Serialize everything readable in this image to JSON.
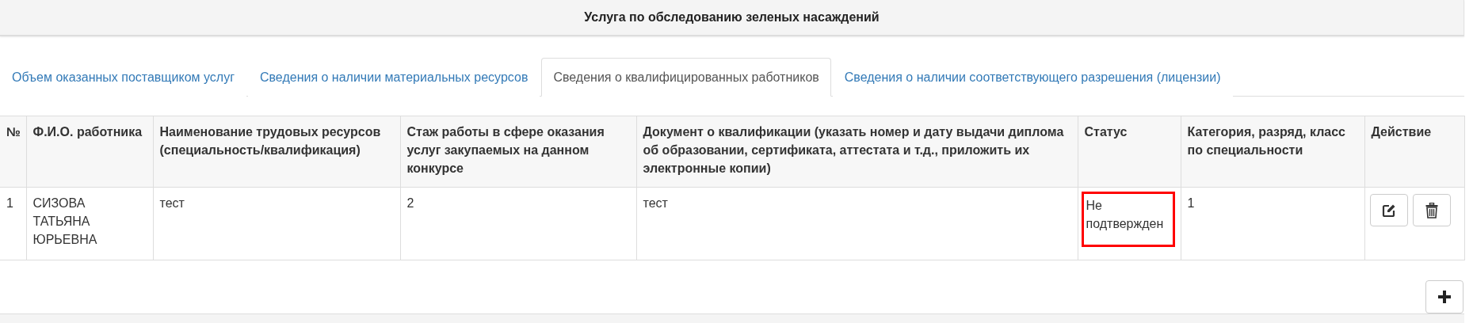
{
  "header": {
    "title": "Услуга по обследованию зеленых насаждений"
  },
  "tabs": [
    {
      "label": "Объем оказанных поставщиком услуг",
      "selected": false
    },
    {
      "label": "Сведения о наличии материальных ресурсов",
      "selected": false
    },
    {
      "label": "Сведения о квалифицированных работников",
      "selected": true
    },
    {
      "label": "Сведения о наличии соответствующего разрешения (лицензии)",
      "selected": false
    }
  ],
  "table": {
    "columns": [
      "№",
      "Ф.И.О. работника",
      "Наименование трудовых ресурсов (специальность/квалификация)",
      "Стаж работы в сфере оказания услуг закупаемых на данном конкурсе",
      "Документ о квалификации (указать номер и дату выдачи диплома об образовании, сертификата, аттестата и т.д., приложить их электронные копии)",
      "Статус",
      "Категория, разряд, класс по специальности",
      "Действие"
    ],
    "rows": [
      {
        "number": "1",
        "name": "СИЗОВА ТАТЬЯНА ЮРЬЕВНА",
        "resource": "тест",
        "experience": "2",
        "document": "тест",
        "status": "Не подтвержден",
        "status_highlighted": true,
        "category": "1"
      }
    ]
  }
}
